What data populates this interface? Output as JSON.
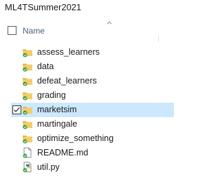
{
  "window": {
    "title": "ML4TSummer2021"
  },
  "header": {
    "name_label": "Name"
  },
  "files": [
    {
      "name": "assess_learners",
      "type": "folder",
      "selected": false
    },
    {
      "name": "data",
      "type": "folder",
      "selected": false
    },
    {
      "name": "defeat_learners",
      "type": "folder",
      "selected": false
    },
    {
      "name": "grading",
      "type": "folder",
      "selected": false
    },
    {
      "name": "marketsim",
      "type": "folder",
      "selected": true
    },
    {
      "name": "martingale",
      "type": "folder",
      "selected": false
    },
    {
      "name": "optimize_something",
      "type": "folder",
      "selected": false
    },
    {
      "name": "README.md",
      "type": "file",
      "selected": false
    },
    {
      "name": "util.py",
      "type": "python-file",
      "selected": false
    }
  ],
  "colors": {
    "folder": "#e8b64a",
    "sync_badge": "#2e9e3a",
    "selection": "#cce8ff",
    "header_text": "#4c607a"
  }
}
